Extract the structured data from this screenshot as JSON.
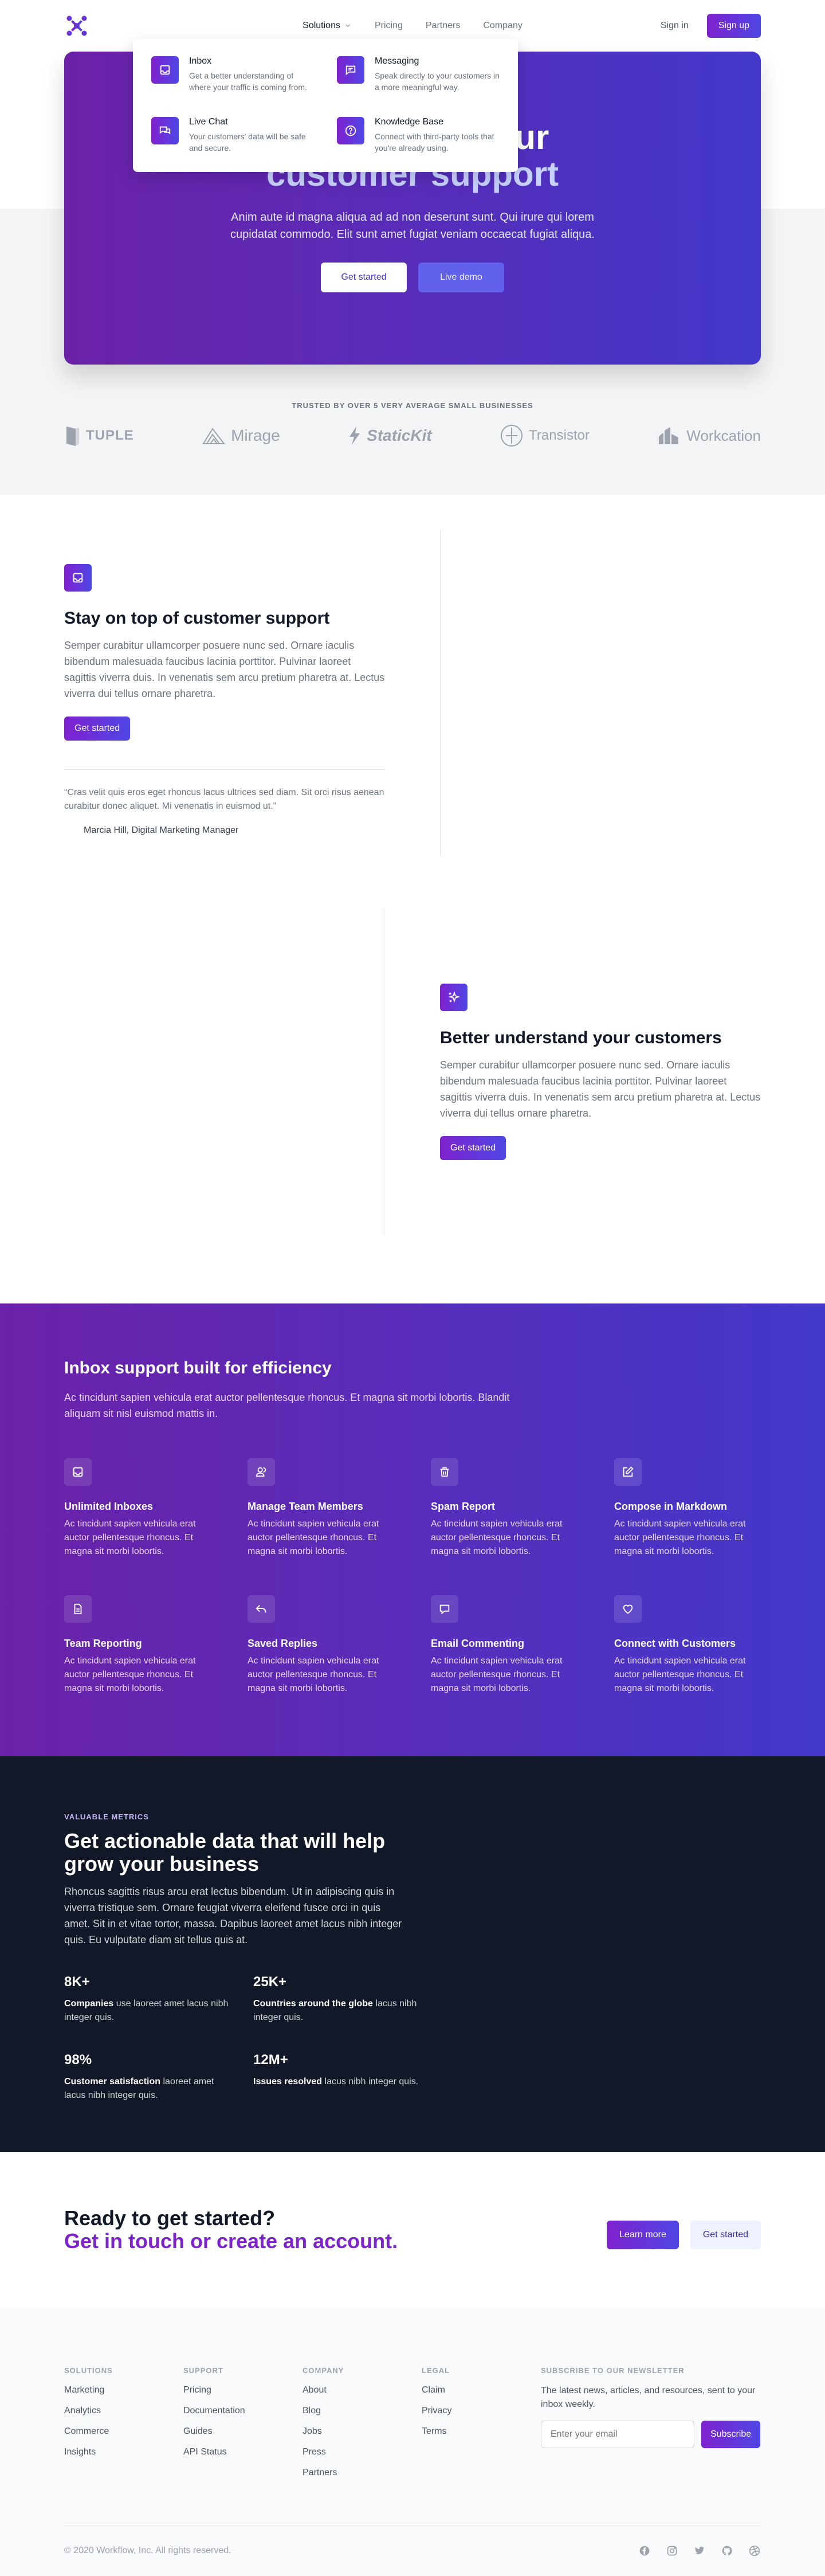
{
  "header": {
    "nav": [
      {
        "label": "Solutions"
      },
      {
        "label": "Pricing"
      },
      {
        "label": "Partners"
      },
      {
        "label": "Company"
      }
    ],
    "sign_in": "Sign in",
    "sign_up": "Sign up"
  },
  "flyout": [
    {
      "title": "Inbox",
      "desc": "Get a better understanding of where your traffic is coming from.",
      "icon": "inbox-icon"
    },
    {
      "title": "Messaging",
      "desc": "Speak directly to your customers in a more meaningful way.",
      "icon": "messaging-icon"
    },
    {
      "title": "Live Chat",
      "desc": "Your customers' data will be safe and secure.",
      "icon": "chat-icon"
    },
    {
      "title": "Knowledge Base",
      "desc": "Connect with third-party tools that you're already using.",
      "icon": "question-icon"
    }
  ],
  "hero": {
    "title_visible": "our",
    "title_light": "customer support",
    "subtitle": "Anim aute id magna aliqua ad ad non deserunt sunt. Qui irure qui lorem cupidatat commodo. Elit sunt amet fugiat veniam occaecat fugiat aliqua.",
    "btn_primary": "Get started",
    "btn_secondary": "Live demo"
  },
  "trusted": {
    "label": "TRUSTED BY OVER 5 VERY AVERAGE SMALL BUSINESSES",
    "logos": [
      "TUPLE",
      "Mirage",
      "StaticKit",
      "Transistor",
      "Workcation"
    ]
  },
  "feature1": {
    "title": "Stay on top of customer support",
    "text": "Semper curabitur ullamcorper posuere nunc sed. Ornare iaculis bibendum malesuada faucibus lacinia porttitor. Pulvinar laoreet sagittis viverra duis. In venenatis sem arcu pretium pharetra at. Lectus viverra dui tellus ornare pharetra.",
    "button": "Get started",
    "quote": "“Cras velit quis eros eget rhoncus lacus ultrices sed diam. Sit orci risus aenean curabitur donec aliquet. Mi venenatis in euismod ut.”",
    "author": "Marcia Hill, Digital Marketing Manager"
  },
  "feature2": {
    "title": "Better understand your customers",
    "text": "Semper curabitur ullamcorper posuere nunc sed. Ornare iaculis bibendum malesuada faucibus lacinia porttitor. Pulvinar laoreet sagittis viverra duis. In venenatis sem arcu pretium pharetra at. Lectus viverra dui tellus ornare pharetra.",
    "button": "Get started"
  },
  "efficiency": {
    "title": "Inbox support built for efficiency",
    "subtitle": "Ac tincidunt sapien vehicula erat auctor pellentesque rhoncus. Et magna sit morbi lobortis. Blandit aliquam sit nisl euismod mattis in.",
    "features": [
      {
        "title": "Unlimited Inboxes",
        "text": "Ac tincidunt sapien vehicula erat auctor pellentesque rhoncus. Et magna sit morbi lobortis.",
        "icon": "inbox-icon"
      },
      {
        "title": "Manage Team Members",
        "text": "Ac tincidunt sapien vehicula erat auctor pellentesque rhoncus. Et magna sit morbi lobortis.",
        "icon": "users-icon"
      },
      {
        "title": "Spam Report",
        "text": "Ac tincidunt sapien vehicula erat auctor pellentesque rhoncus. Et magna sit morbi lobortis.",
        "icon": "trash-icon"
      },
      {
        "title": "Compose in Markdown",
        "text": "Ac tincidunt sapien vehicula erat auctor pellentesque rhoncus. Et magna sit morbi lobortis.",
        "icon": "pencil-icon"
      },
      {
        "title": "Team Reporting",
        "text": "Ac tincidunt sapien vehicula erat auctor pellentesque rhoncus. Et magna sit morbi lobortis.",
        "icon": "document-icon"
      },
      {
        "title": "Saved Replies",
        "text": "Ac tincidunt sapien vehicula erat auctor pellentesque rhoncus. Et magna sit morbi lobortis.",
        "icon": "reply-icon"
      },
      {
        "title": "Email Commenting",
        "text": "Ac tincidunt sapien vehicula erat auctor pellentesque rhoncus. Et magna sit morbi lobortis.",
        "icon": "comment-icon"
      },
      {
        "title": "Connect with Customers",
        "text": "Ac tincidunt sapien vehicula erat auctor pellentesque rhoncus. Et magna sit morbi lobortis.",
        "icon": "heart-icon"
      }
    ]
  },
  "metrics": {
    "kicker": "VALUABLE METRICS",
    "title": "Get actionable data that will help grow your business",
    "text": "Rhoncus sagittis risus arcu erat lectus bibendum. Ut in adipiscing quis in viverra tristique sem. Ornare feugiat viverra eleifend fusce orci in quis amet. Sit in et vitae tortor, massa. Dapibus laoreet amet lacus nibh integer quis. Eu vulputate diam sit tellus quis at.",
    "items": [
      {
        "value": "8K+",
        "bold": "Companies",
        "rest": " use laoreet amet lacus nibh integer quis."
      },
      {
        "value": "25K+",
        "bold": "Countries around the globe",
        "rest": " lacus nibh integer quis."
      },
      {
        "value": "98%",
        "bold": "Customer satisfaction",
        "rest": " laoreet amet lacus nibh integer quis."
      },
      {
        "value": "12M+",
        "bold": "Issues resolved",
        "rest": " lacus nibh integer quis."
      }
    ]
  },
  "cta": {
    "title": "Ready to get started?",
    "title2": "Get in touch or create an account.",
    "learn_more": "Learn more",
    "get_started": "Get started"
  },
  "footer": {
    "columns": [
      {
        "head": "SOLUTIONS",
        "links": [
          "Marketing",
          "Analytics",
          "Commerce",
          "Insights"
        ]
      },
      {
        "head": "SUPPORT",
        "links": [
          "Pricing",
          "Documentation",
          "Guides",
          "API Status"
        ]
      },
      {
        "head": "COMPANY",
        "links": [
          "About",
          "Blog",
          "Jobs",
          "Press",
          "Partners"
        ]
      },
      {
        "head": "LEGAL",
        "links": [
          "Claim",
          "Privacy",
          "Terms"
        ]
      }
    ],
    "newsletter_head": "SUBSCRIBE TO OUR NEWSLETTER",
    "newsletter_text": "The latest news, articles, and resources, sent to your inbox weekly.",
    "email_placeholder": "Enter your email",
    "subscribe": "Subscribe",
    "copyright": "© 2020 Workflow, Inc. All rights reserved.",
    "social": [
      "facebook-icon",
      "instagram-icon",
      "twitter-icon",
      "github-icon",
      "dribbble-icon"
    ]
  },
  "colors": {
    "accent_start": "#7e22ce",
    "accent_end": "#4f46e5",
    "dark": "#111827"
  }
}
